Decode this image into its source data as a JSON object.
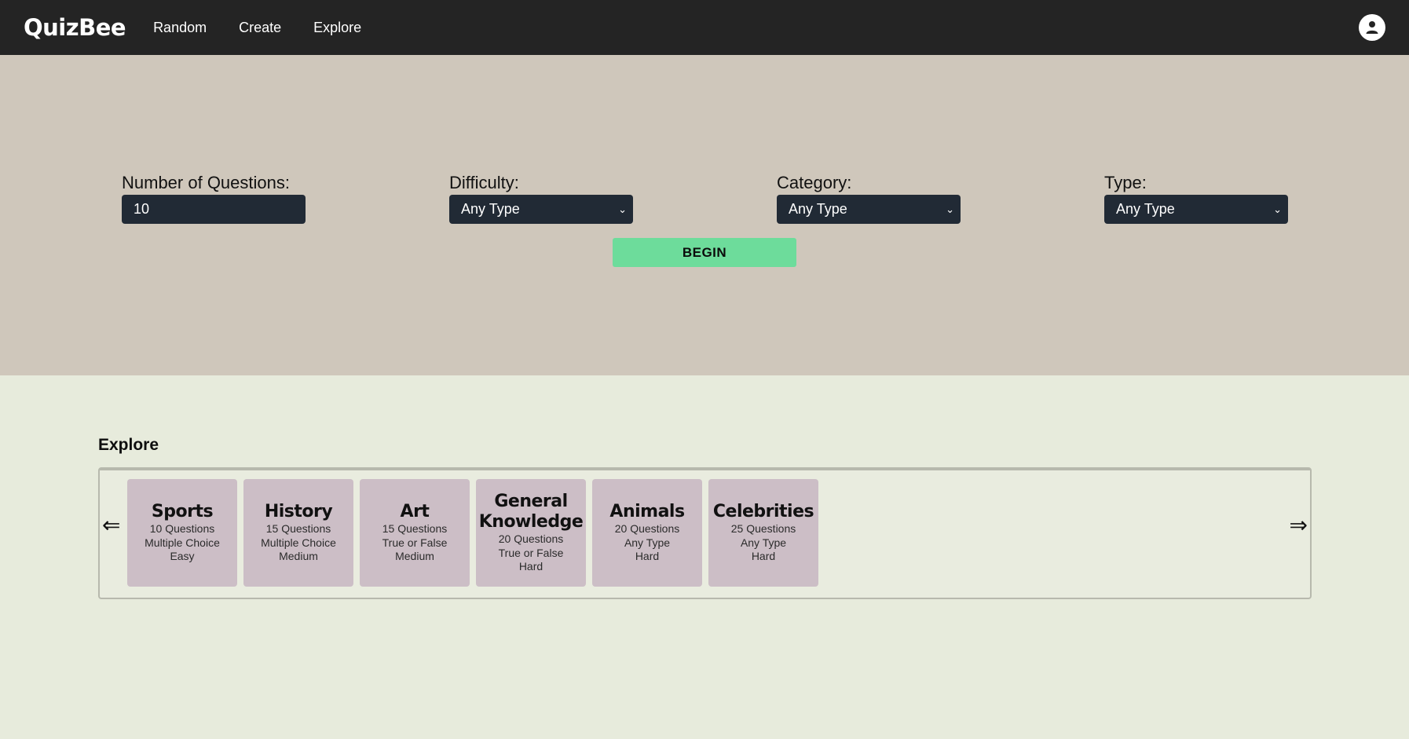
{
  "navbar": {
    "brand": "QuizBee",
    "links": [
      "Random",
      "Create",
      "Explore"
    ],
    "avatar_icon": "user-icon"
  },
  "form": {
    "questions": {
      "label": "Number of Questions:",
      "value": "10"
    },
    "difficulty": {
      "label": "Difficulty:",
      "selected": "Any Type"
    },
    "category": {
      "label": "Category:",
      "selected": "Any Type"
    },
    "type": {
      "label": "Type:",
      "selected": "Any Type"
    },
    "begin_label": "BEGIN"
  },
  "explore": {
    "title": "Explore",
    "prev_arrow": "⇐",
    "next_arrow": "⇒",
    "cards": [
      {
        "title": "Sports",
        "questions": "10 Questions",
        "type": "Multiple Choice",
        "difficulty": "Easy"
      },
      {
        "title": "History",
        "questions": "15 Questions",
        "type": "Multiple Choice",
        "difficulty": "Medium"
      },
      {
        "title": "Art",
        "questions": "15 Questions",
        "type": "True or False",
        "difficulty": "Medium"
      },
      {
        "title": "General Knowledge",
        "questions": "20 Questions",
        "type": "True or False",
        "difficulty": "Hard"
      },
      {
        "title": "Animals",
        "questions": "20 Questions",
        "type": "Any Type",
        "difficulty": "Hard"
      },
      {
        "title": "Celebrities",
        "questions": "25 Questions",
        "type": "Any Type",
        "difficulty": "Hard"
      }
    ]
  },
  "colors": {
    "navbar": "#242424",
    "hero": "#cfc7bb",
    "explore_bg": "#e7ebdc",
    "control": "#212a35",
    "begin": "#6ddc9b",
    "card": "#ccbec6"
  }
}
